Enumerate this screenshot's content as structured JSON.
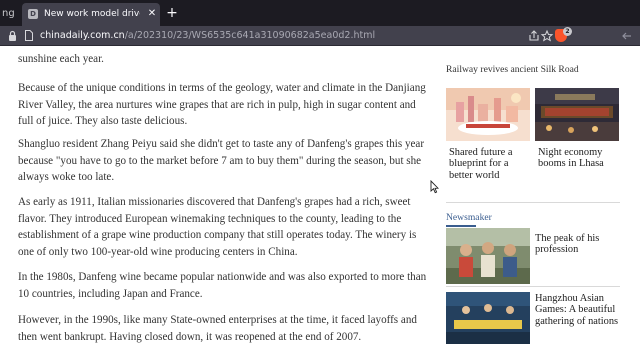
{
  "browser": {
    "prev_tab_label": "ng",
    "tab": {
      "favicon": "D",
      "title": "New work model drives wineries",
      "close": "✕"
    },
    "new_tab": "+",
    "url": {
      "host": "chinadaily.com.cn",
      "path": "/a/202310/23/WS6535c641a31090682a5ea0d2.html"
    },
    "brave_badge": "2",
    "icons": [
      "lock-icon",
      "page-icon",
      "share-icon",
      "star-icon",
      "brave-shield-icon",
      "back-icon"
    ]
  },
  "article": {
    "paragraphs": [
      "sunshine each year.",
      "Because of the unique conditions in terms of the geology, water and climate in the Danjiang River Valley, the area nurtures wine grapes that are rich in pulp, high in sugar content and full of juice. They also taste delicious.",
      "Shangluo resident Zhang Peiyu said she didn't get to taste any of Danfeng's grapes this year because \"you have to go to the market before 7 am to buy them\" during the season, but she always woke too late.",
      "As early as 1911, Italian missionaries discovered that Danfeng's grapes had a rich, sweet flavor. They introduced European winemaking techniques to the county, leading to the establishment of a grape wine production company that still operates today. The winery is one of only two 100-year-old wine producing centers in China.",
      "In the 1980s, Danfeng wine became popular nationwide and was also exported to more than 10 countries, including Japan and France.",
      "However, in the 1990s, like many State-owned enterprises at the time, it faced layoffs and then went bankrupt. Having closed down, it was reopened at the end of 2007."
    ]
  },
  "sidebar": {
    "top_caption": "Railway revives ancient Silk Road",
    "cards": [
      {
        "title": "Shared future a blueprint for a better world"
      },
      {
        "title": "Night economy booms in Lhasa"
      }
    ],
    "section_label": "Newsmaker",
    "newsmaker": [
      {
        "title": "The peak of his profession"
      },
      {
        "title": "Hangzhou Asian Games: A beautiful gathering of nations"
      }
    ]
  },
  "colors": {
    "tabbar": "#1c1b22",
    "toolbar": "#42414d",
    "body_text": "#333333",
    "section_accent": "#3a5d8f"
  }
}
